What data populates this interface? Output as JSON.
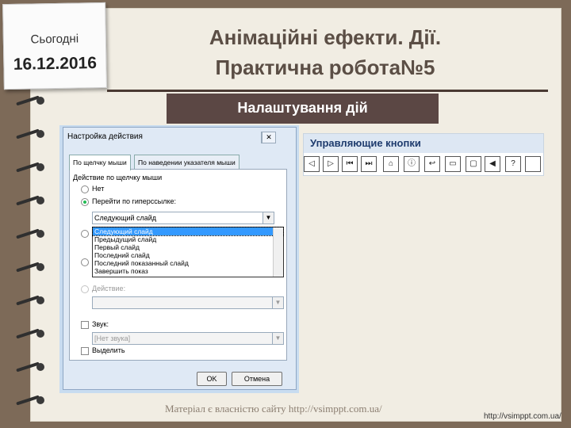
{
  "note": {
    "today_label": "Сьогодні",
    "date": "16.12.2016"
  },
  "title": {
    "line1": "Анімаційні ефекти. Дії.",
    "line2": "Практична робота№5"
  },
  "subheading": "Налаштування дій",
  "dialog": {
    "title": "Настройка действия",
    "close": "✕",
    "help": "?",
    "tabs": [
      "По щелчку мыши",
      "По наведении указателя мыши"
    ],
    "section_label": "Действие по щелчку мыши",
    "option_none": "Нет",
    "option_hyperlink": "Перейти по гиперссылке:",
    "hyperlink_value": "Следующий слайд",
    "dropdown_items": [
      "Следующий слайд",
      "Предыдущий слайд",
      "Первый слайд",
      "Последний слайд",
      "Последний показанный слайд",
      "Завершить показ"
    ],
    "option_action": "Действие:",
    "sound_label": "Звук:",
    "sound_value": "[Нет звука]",
    "highlight_label": "Выделить",
    "ok": "OK",
    "cancel": "Отмена"
  },
  "control_buttons": {
    "heading": "Управляющие кнопки",
    "icons": [
      "◁",
      "▷",
      "⏮",
      "⏭",
      "⌂",
      "ⓘ",
      "↩",
      "▭",
      "▢",
      "◀",
      "?",
      ""
    ]
  },
  "footer": {
    "ownership": "Матеріал є власністю сайту http://vsimppt.com.ua/",
    "url": "http://vsimppt.com.ua/"
  }
}
